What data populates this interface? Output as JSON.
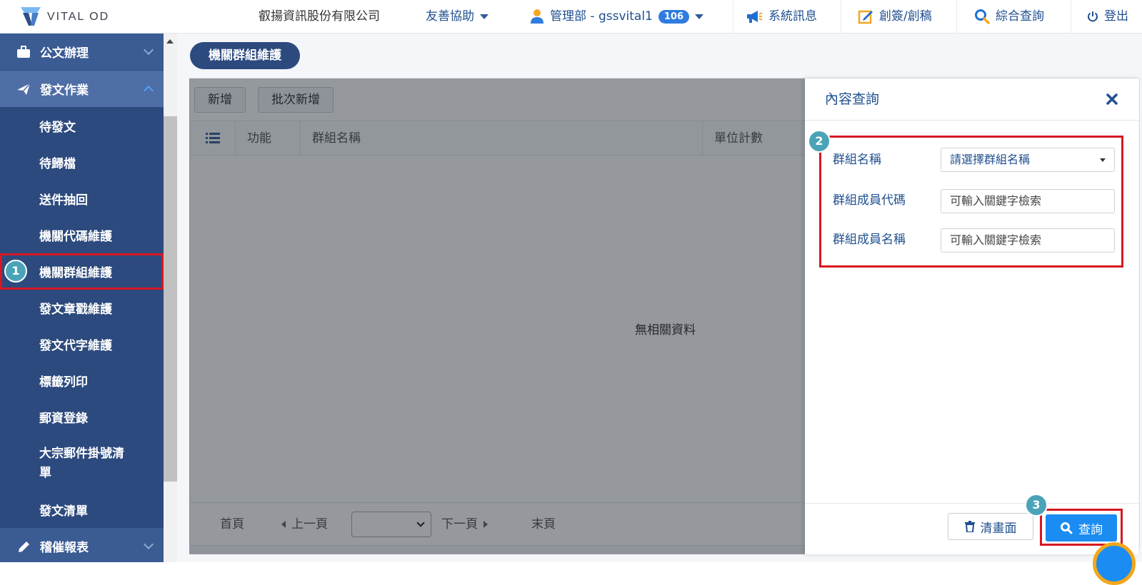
{
  "brand": {
    "logo_text": "VITAL OD"
  },
  "topbar": {
    "company": "叡揚資訊股份有限公司",
    "assist_label": "友善協助",
    "user_label": "管理部 - gssvital1",
    "user_badge": "106",
    "sys_msg_label": "系統訊息",
    "create_label": "創簽/創稿",
    "search_label": "綜合查詢",
    "logout_label": "登出"
  },
  "sidebar": {
    "groups": [
      {
        "label": "公文辦理"
      },
      {
        "label": "發文作業"
      },
      {
        "label": "稽催報表"
      }
    ],
    "items": [
      {
        "label": "待發文"
      },
      {
        "label": "待歸檔"
      },
      {
        "label": "送件抽回"
      },
      {
        "label": "機關代碼維護"
      },
      {
        "label": "機關群組維護"
      },
      {
        "label": "發文章戳維護"
      },
      {
        "label": "發文代字維護"
      },
      {
        "label": "標籤列印"
      },
      {
        "label": "郵資登錄"
      },
      {
        "label": "大宗郵件掛號清單"
      },
      {
        "label": "發文清單"
      }
    ]
  },
  "steps": {
    "one": "1",
    "two": "2",
    "three": "3"
  },
  "main": {
    "page_title": "機關群組維護",
    "toolbar": {
      "add_label": "新增",
      "batch_add_label": "批次新增"
    },
    "columns": {
      "function": "功能",
      "group_name": "群組名稱",
      "unit_count": "單位計數"
    },
    "empty_text": "無相關資料",
    "pager": {
      "first": "首頁",
      "prev": "上一頁",
      "next": "下一頁",
      "last": "末頁"
    }
  },
  "drawer": {
    "title": "內容查詢",
    "fields": [
      {
        "label": "群組名稱",
        "value": "請選擇群組名稱"
      },
      {
        "label": "群組成員代碼",
        "placeholder": "可輸入關鍵字檢索"
      },
      {
        "label": "群組成員名稱",
        "placeholder": "可輸入關鍵字檢索"
      }
    ],
    "clear_label": "清畫面",
    "query_label": "查詢"
  },
  "colors": {
    "sidebar": "#2c4a7e",
    "accent": "#1b8cf2",
    "highlight": "#d61822",
    "step": "#4ba3b8"
  }
}
